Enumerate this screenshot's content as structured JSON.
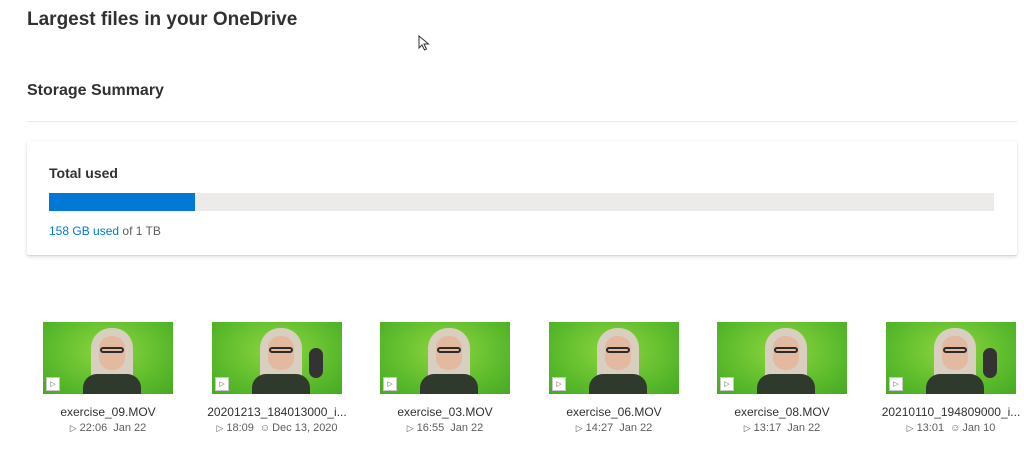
{
  "page": {
    "title": "Largest files in your OneDrive"
  },
  "storage": {
    "section_title": "Storage Summary",
    "label": "Total used",
    "used": "158 GB used",
    "of": " of ",
    "total": "1 TB",
    "used_fraction": 0.154,
    "fill_color": "#0078d4"
  },
  "files": [
    {
      "name": "exercise_09.MOV",
      "duration": "22:06",
      "date": "Jan 22",
      "shared": false,
      "has_mic": false
    },
    {
      "name": "20201213_184013000_i...",
      "duration": "18:09",
      "date": "Dec 13, 2020",
      "shared": true,
      "has_mic": true
    },
    {
      "name": "exercise_03.MOV",
      "duration": "16:55",
      "date": "Jan 22",
      "shared": false,
      "has_mic": false
    },
    {
      "name": "exercise_06.MOV",
      "duration": "14:27",
      "date": "Jan 22",
      "shared": false,
      "has_mic": false
    },
    {
      "name": "exercise_08.MOV",
      "duration": "13:17",
      "date": "Jan 22",
      "shared": false,
      "has_mic": false
    },
    {
      "name": "20210110_194809000_i...",
      "duration": "13:01",
      "date": "Jan 10",
      "shared": true,
      "has_mic": true
    }
  ],
  "icons": {
    "play": "play-icon",
    "shared": "shared-people-icon",
    "cursor": "mouse-pointer-icon"
  }
}
